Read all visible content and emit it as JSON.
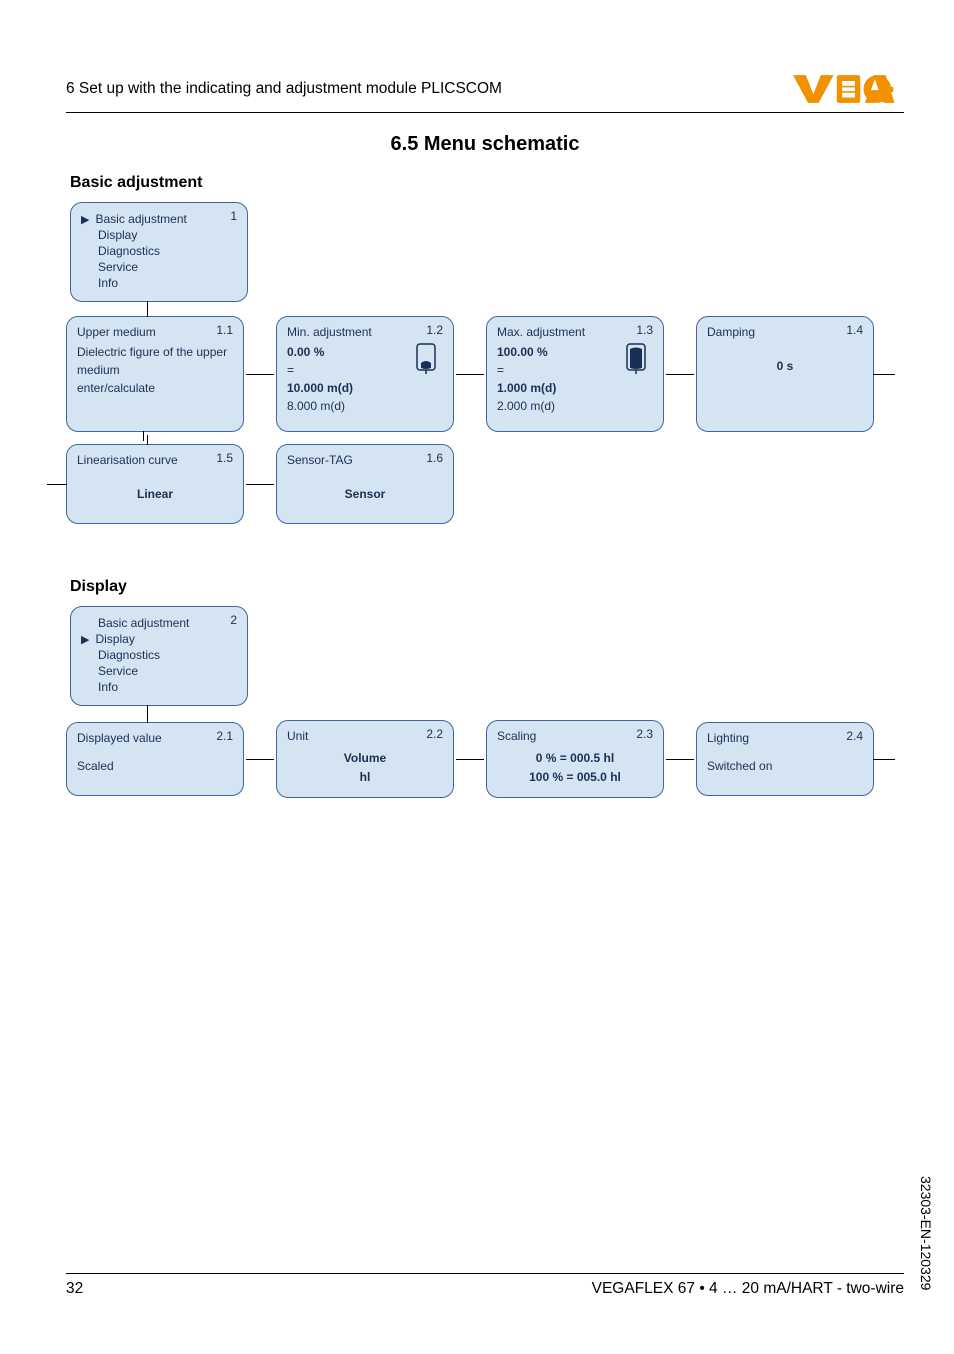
{
  "header": {
    "chapter_label": "6   Set up with the indicating and adjustment module PLICSCOM"
  },
  "section_title": "6.5   Menu schematic",
  "basic_adjustment": {
    "heading": "Basic adjustment",
    "root_menu": {
      "num": "1",
      "items": [
        "Basic adjustment",
        "Display",
        "Diagnostics",
        "Service",
        "Info"
      ],
      "selected_index": 0
    },
    "row1": [
      {
        "num": "1.1",
        "title": "Upper medium",
        "lines": [
          "Dielectric figure of the upper medium",
          "enter/calculate"
        ]
      },
      {
        "num": "1.2",
        "title": "Min. adjustment",
        "bold": "0.00 %",
        "lines_pre": "=",
        "bold2": "10.000 m(d)",
        "lines_after": "8.000 m(d)",
        "icon": "min-icon"
      },
      {
        "num": "1.3",
        "title": "Max. adjustment",
        "bold": "100.00 %",
        "lines_pre": "=",
        "bold2": "1.000 m(d)",
        "lines_after": "2.000 m(d)",
        "icon": "max-icon"
      },
      {
        "num": "1.4",
        "title": "Damping",
        "center_bold": "0 s"
      }
    ],
    "row2": [
      {
        "num": "1.5",
        "title": "Linearisation curve",
        "center_bold": "Linear"
      },
      {
        "num": "1.6",
        "title": "Sensor-TAG",
        "center_bold": "Sensor"
      }
    ]
  },
  "display": {
    "heading": "Display",
    "root_menu": {
      "num": "2",
      "items": [
        "Basic adjustment",
        "Display",
        "Diagnostics",
        "Service",
        "Info"
      ],
      "selected_index": 1
    },
    "row": [
      {
        "num": "2.1",
        "title": "Displayed value",
        "center_bold": "Scaled"
      },
      {
        "num": "2.2",
        "title": "Unit",
        "center_lines": [
          "Volume",
          "hl"
        ]
      },
      {
        "num": "2.3",
        "title": "Scaling",
        "center_lines": [
          "0 % = 000.5 hl",
          "100 % = 005.0 hl"
        ]
      },
      {
        "num": "2.4",
        "title": "Lighting",
        "center_bold": "Switched on"
      }
    ]
  },
  "footer": {
    "page": "32",
    "product": "VEGAFLEX 67 • 4 … 20 mA/HART - two-wire"
  },
  "doc_id": "32303-EN-120329"
}
